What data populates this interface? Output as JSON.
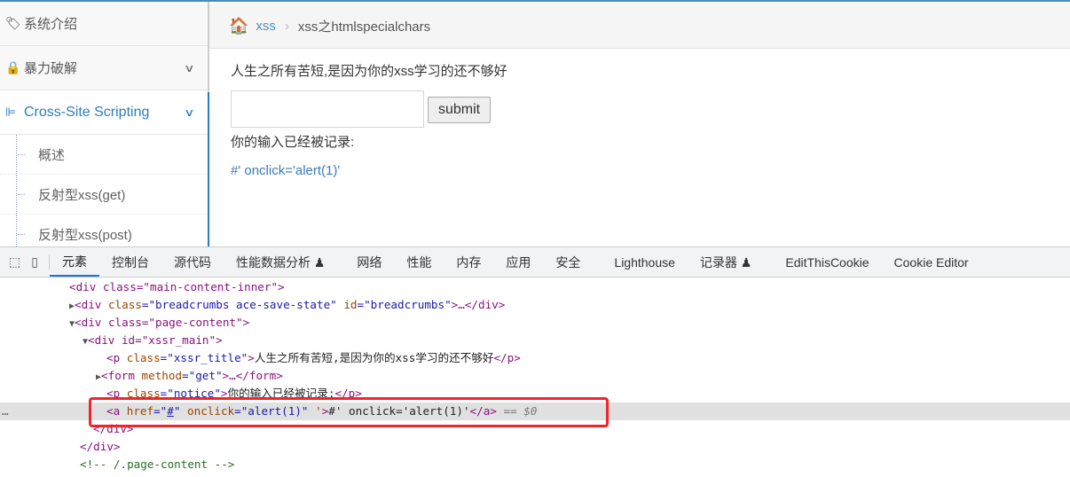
{
  "sidebar": {
    "items": [
      {
        "label": "系统介绍",
        "icon": "tags-icon"
      },
      {
        "label": "暴力破解",
        "icon": "lock-icon"
      },
      {
        "label": "Cross-Site Scripting",
        "icon": "sitemap-icon"
      }
    ],
    "subitems": [
      "概述",
      "反射型xss(get)",
      "反射型xss(post)"
    ]
  },
  "breadcrumb": {
    "parent": "xss",
    "current": "xss之htmlspecialchars"
  },
  "main": {
    "title": "人生之所有苦短,是因为你的xss学习的还不够好",
    "input_value": "",
    "submit_label": "submit",
    "notice": "你的输入已经被记录:",
    "link_text": "#' onclick='alert(1)'"
  },
  "devtools": {
    "tabs": [
      "元素",
      "控制台",
      "源代码",
      "性能数据分析 ♟",
      "网络",
      "性能",
      "内存",
      "应用",
      "安全",
      "Lighthouse",
      "记录器 ♟",
      "EditThisCookie",
      "Cookie Editor"
    ],
    "lines": {
      "l0": "<div class=\"main-content-inner\">",
      "l1a": "<div ",
      "l1b": "class",
      "l1c": "=\"breadcrumbs ace-save-state\" ",
      "l1d": "id",
      "l1e": "=\"breadcrumbs\"",
      "l1f": ">…</div>",
      "l2": "<div class=\"page-content\">",
      "l3": "<div id=\"xssr_main\">",
      "l4": "人生之所有苦短,是因为你的xss学习的还不够好",
      "l6": "你的输入已经被记录:",
      "l7text": "#' onclick='alert(1)'",
      "l7end": "== $0",
      "l10": "<!-- /.page-content -->"
    }
  },
  "colors": {
    "accent": "#2b7dbc",
    "highlight": "#f2242a"
  }
}
